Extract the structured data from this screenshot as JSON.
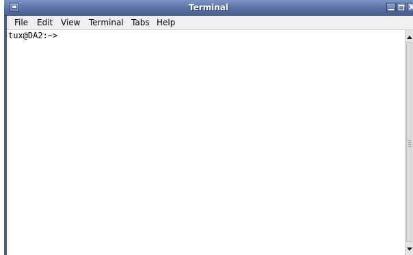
{
  "window": {
    "title": "Terminal",
    "icons": [
      "terminal-icon",
      "minimize-icon",
      "maximize-icon",
      "close-icon"
    ],
    "close_glyph": "X"
  },
  "menubar": {
    "items": [
      {
        "label": "File"
      },
      {
        "label": "Edit"
      },
      {
        "label": "View"
      },
      {
        "label": "Terminal"
      },
      {
        "label": "Tabs"
      },
      {
        "label": "Help"
      }
    ]
  },
  "terminal": {
    "prompt": "tux@DA2:~>"
  },
  "colors": {
    "titlebar": "#5b72a7",
    "menubar": "#efefef",
    "terminal_bg": "#ffffff"
  }
}
